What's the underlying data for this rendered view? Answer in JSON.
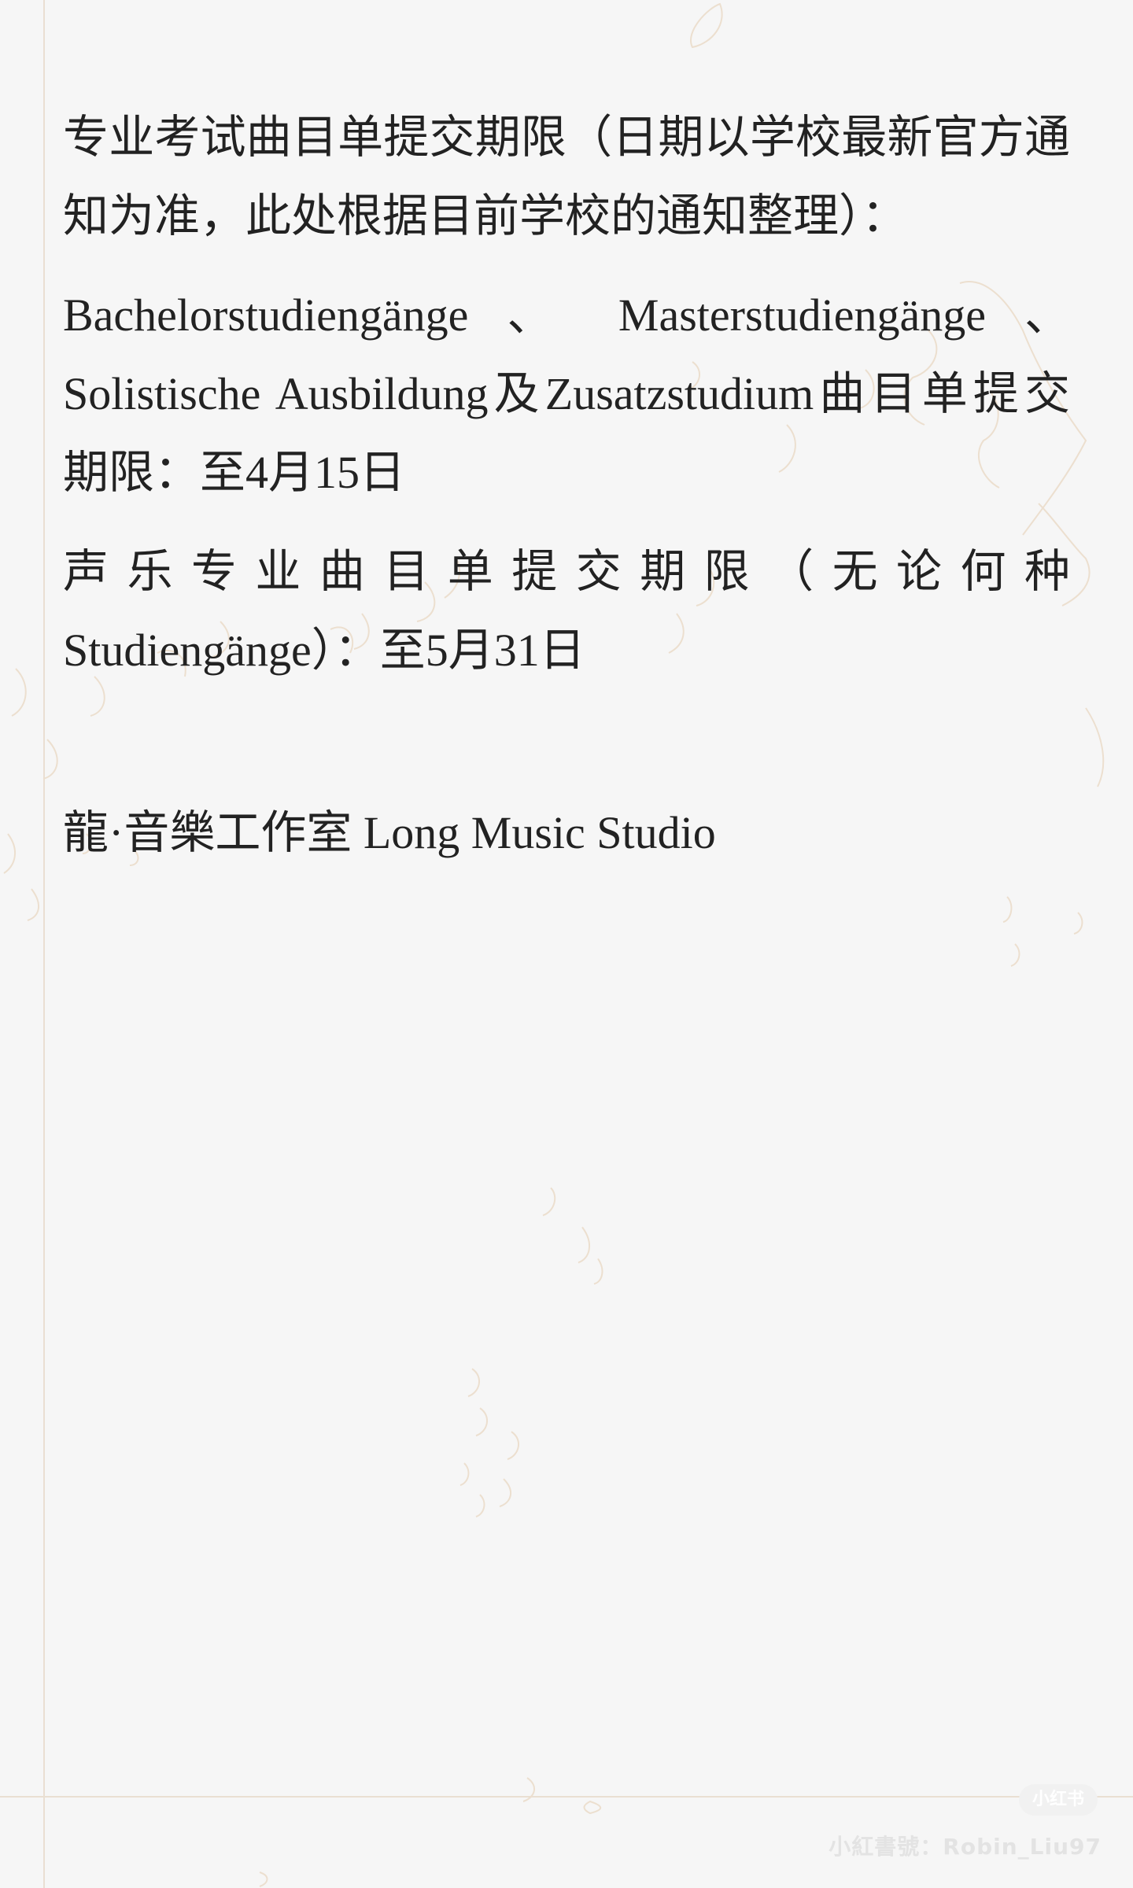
{
  "document": {
    "paragraphs": [
      "专业考试曲目单提交期限（日期以学校最新官方通知为准，此处根据目前学校的通知整理）：",
      "Bachelorstudiengänge 、 Masterstudiengänge 、 Solistische Ausbildung及Zusatzstudium曲目单提交期限：至4月15日",
      "声乐专业曲目单提交期限（无论何种Studiengänge）：至5月31日"
    ],
    "signature": "龍·音樂工作室 Long Music Studio"
  },
  "watermark": {
    "logo": "小红书",
    "handle": "小紅書號：Robin_Liu97"
  },
  "colors": {
    "background": "#f6f6f6",
    "text": "#222222",
    "margin_line": "#eadfd2",
    "decor_lines": "#ecdfcf"
  }
}
